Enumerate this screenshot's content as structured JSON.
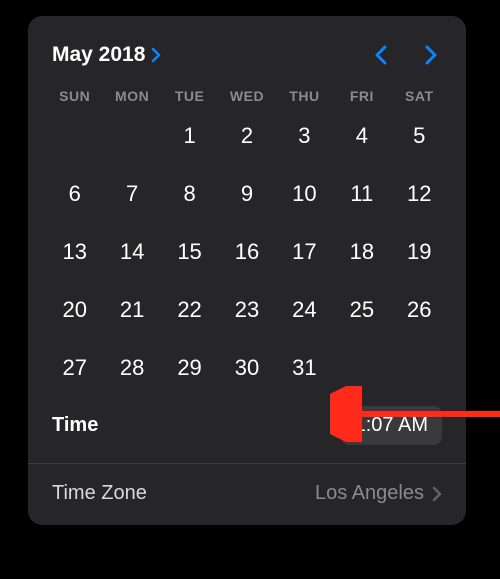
{
  "header": {
    "monthYear": "May 2018"
  },
  "weekdays": [
    "SUN",
    "MON",
    "TUE",
    "WED",
    "THU",
    "FRI",
    "SAT"
  ],
  "days": [
    "",
    "",
    "1",
    "2",
    "3",
    "4",
    "5",
    "6",
    "7",
    "8",
    "9",
    "10",
    "11",
    "12",
    "13",
    "14",
    "15",
    "16",
    "17",
    "18",
    "19",
    "20",
    "21",
    "22",
    "23",
    "24",
    "25",
    "26",
    "27",
    "28",
    "29",
    "30",
    "31",
    "",
    ""
  ],
  "time": {
    "label": "Time",
    "value": "1:07 AM"
  },
  "timezone": {
    "label": "Time Zone",
    "value": "Los Angeles"
  }
}
